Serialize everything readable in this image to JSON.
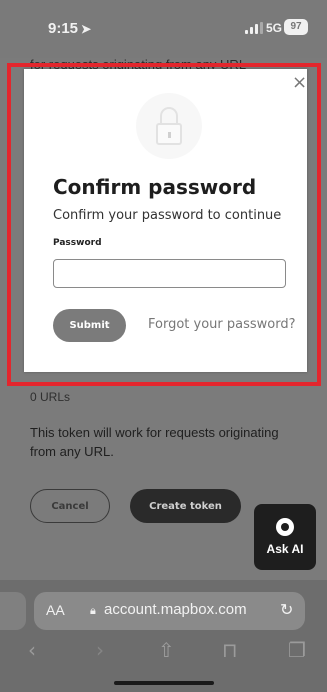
{
  "status_bar": {
    "time": "9:15",
    "network": "5G",
    "battery": "97"
  },
  "background_page": {
    "peek_text": "for requests originating from any URL",
    "urls_count": "0 URLs",
    "description": "This token will work for requests originating from any URL.",
    "cancel_label": "Cancel",
    "create_label": "Create token",
    "ask_ai_label": "Ask AI"
  },
  "modal": {
    "title": "Confirm password",
    "subtitle": "Confirm your password to continue",
    "field_label": "Password",
    "password_value": "",
    "submit_label": "Submit",
    "forgot_label": "Forgot your password?",
    "highlight_color": "#e3262d"
  },
  "browser": {
    "text_size_label": "AA",
    "domain": "account.mapbox.com",
    "toolbar_icons": [
      "back-icon",
      "forward-icon",
      "share-icon",
      "bookmarks-icon",
      "tabs-icon"
    ]
  }
}
